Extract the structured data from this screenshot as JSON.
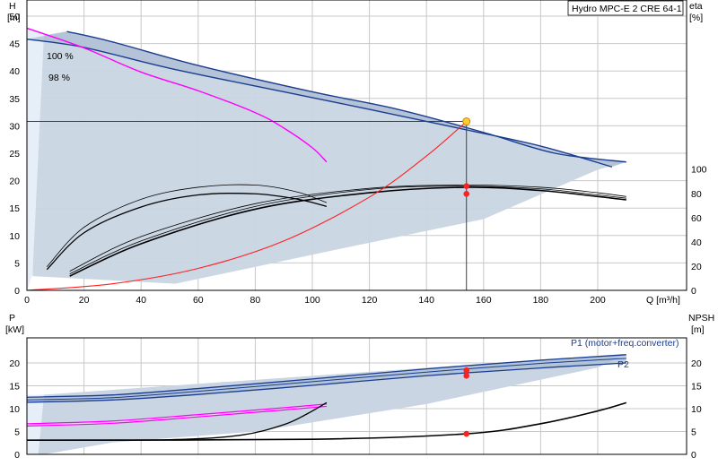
{
  "title": "Hydro MPC-E 2 CRE 64-1",
  "colors": {
    "band_fill": "#c9d5e3",
    "band_edge": "#1a3d8f",
    "system_curve": "#ff2020",
    "magenta": "#ff00ff",
    "duty_point": "#ff2020",
    "duty_marker": "#ffcc33",
    "grid": "#c8c8c8"
  },
  "chart_data": [
    {
      "type": "line",
      "panel": "top",
      "xlabel": "Q [m³/h]",
      "ylabel_left": [
        "H",
        "[m]"
      ],
      "ylabel_right": [
        "eta",
        "[%]"
      ],
      "x_range": [
        0,
        220
      ],
      "y_range": [
        0,
        53
      ],
      "x_ticks": [
        0,
        20,
        40,
        60,
        80,
        100,
        120,
        140,
        160,
        180,
        200
      ],
      "y_ticks": [
        0,
        5,
        10,
        15,
        20,
        25,
        30,
        35,
        40,
        45,
        50
      ],
      "y2_range": [
        0,
        100
      ],
      "y2_ticks": [
        0,
        20,
        40,
        60,
        80,
        100
      ],
      "annotations": [
        "100 %",
        "98 %"
      ],
      "series": [
        {
          "role": "head_100",
          "x": [
            14,
            30,
            60,
            100,
            130,
            160,
            185,
            210
          ],
          "y": [
            47.2,
            45.3,
            41,
            36.2,
            33,
            28.8,
            25,
            23.4
          ]
        },
        {
          "role": "head_98",
          "x": [
            0,
            20,
            50,
            90,
            120,
            150,
            180,
            205
          ],
          "y": [
            45.8,
            44.3,
            40.5,
            36.2,
            33,
            29.7,
            26.3,
            22.5
          ]
        },
        {
          "role": "head_single",
          "x": [
            0,
            20,
            40,
            60,
            80,
            90,
            100,
            105
          ],
          "y": [
            47.8,
            44.2,
            39.8,
            36.4,
            32.4,
            29.6,
            26,
            23.4
          ]
        },
        {
          "role": "system",
          "x": [
            0,
            30,
            60,
            90,
            120,
            140,
            154
          ],
          "y": [
            0,
            1.2,
            4,
            9,
            17,
            24.5,
            30.8
          ]
        },
        {
          "role": "eta_combined_1",
          "x": [
            15,
            40,
            80,
            120,
            154,
            180,
            200,
            210
          ],
          "y": [
            2.6,
            8.5,
            14.8,
            17.8,
            18.8,
            18.2,
            17.1,
            16.5
          ]
        },
        {
          "role": "eta_combined_2",
          "x": [
            15,
            40,
            80,
            120,
            154,
            180,
            200,
            210
          ],
          "y": [
            3,
            9,
            15.3,
            18.4,
            19,
            18.5,
            17.4,
            16.8
          ]
        },
        {
          "role": "eta_combined_3",
          "x": [
            15,
            40,
            80,
            120,
            154,
            180,
            200,
            210
          ],
          "y": [
            3.5,
            9.8,
            15.8,
            18.6,
            19.2,
            18.8,
            17.8,
            17.1
          ]
        },
        {
          "role": "eta_single_1",
          "x": [
            7,
            20,
            40,
            60,
            80,
            95,
            105
          ],
          "y": [
            3.8,
            10.5,
            15.2,
            17.4,
            17.6,
            16.6,
            15.3
          ]
        },
        {
          "role": "eta_single_2",
          "x": [
            7,
            20,
            40,
            60,
            80,
            95,
            105
          ],
          "y": [
            4.3,
            11.5,
            16.6,
            18.8,
            19.2,
            17.9,
            16
          ]
        }
      ],
      "duty_points": [
        {
          "x": 154,
          "y": 30.8,
          "marker": "yellow"
        },
        {
          "x": 154,
          "y": 19,
          "marker": "red"
        },
        {
          "x": 154,
          "y": 17.6,
          "marker": "red"
        }
      ],
      "reference_lines": {
        "duty_q": 154,
        "duty_h": 30.8
      }
    },
    {
      "type": "line",
      "panel": "bottom",
      "ylabel_left": [
        "P",
        "[kW]"
      ],
      "ylabel_right": [
        "NPSH",
        "[m]"
      ],
      "x_range": [
        0,
        220
      ],
      "y_range": [
        0,
        24.5
      ],
      "y_ticks": [
        0,
        5,
        10,
        15,
        20
      ],
      "y2_ticks": [
        0,
        5,
        10,
        15,
        20
      ],
      "legend": [
        "P1 (motor+freq.converter)",
        "P2"
      ],
      "series": [
        {
          "role": "p1",
          "x": [
            0,
            30,
            60,
            100,
            140,
            180,
            210
          ],
          "y": [
            12.5,
            13,
            14.4,
            16.5,
            18.7,
            20.6,
            21.8
          ]
        },
        {
          "role": "p1b",
          "x": [
            0,
            30,
            60,
            100,
            140,
            180,
            210
          ],
          "y": [
            11.9,
            12.4,
            13.8,
            15.9,
            18,
            19.9,
            21
          ]
        },
        {
          "role": "p2",
          "x": [
            0,
            30,
            60,
            100,
            140,
            180,
            210
          ],
          "y": [
            11.4,
            11.9,
            13.1,
            15.1,
            17.2,
            18.9,
            20
          ]
        },
        {
          "role": "p_single_1",
          "x": [
            0,
            30,
            60,
            90,
            105
          ],
          "y": [
            6.7,
            7.3,
            8.7,
            10.2,
            11
          ]
        },
        {
          "role": "p_single_2",
          "x": [
            0,
            30,
            60,
            90,
            105
          ],
          "y": [
            6.2,
            6.8,
            8.2,
            9.7,
            10.5
          ]
        },
        {
          "role": "npsh_single",
          "x": [
            0,
            50,
            75,
            90,
            98,
            105
          ],
          "y": [
            3.1,
            3.2,
            4.2,
            6.5,
            8.8,
            11.3
          ]
        },
        {
          "role": "npsh",
          "x": [
            0,
            100,
            154,
            180,
            200,
            210
          ],
          "y": [
            3.1,
            3.3,
            4.5,
            6.7,
            9.5,
            11.3
          ]
        }
      ],
      "duty_points": [
        {
          "x": 154,
          "y": 18.4
        },
        {
          "x": 154,
          "y": 17.2
        },
        {
          "x": 154,
          "y": 4.5
        }
      ]
    }
  ]
}
